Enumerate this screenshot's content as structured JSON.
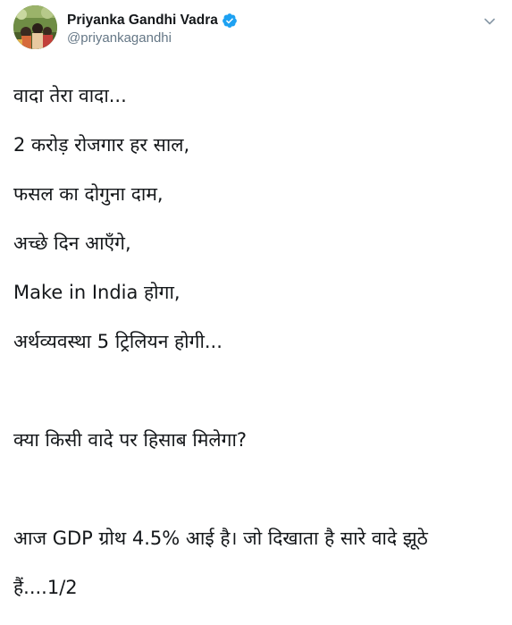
{
  "tweet": {
    "author": {
      "display_name": "Priyanka Gandhi Vadra",
      "handle": "@priyankagandhi",
      "verified": true,
      "avatar_icon": "profile-photo"
    },
    "menu_icon": "chevron-down-icon",
    "text_lines": [
      "वादा तेरा वादा...",
      "2 करोड़ रोजगार हर साल,",
      "फसल का दोगुना दाम,",
      "अच्छे दिन आएँगे,",
      "Make in India होगा,",
      "अर्थव्यवस्था 5 ट्रिलियन होगी...",
      "",
      "क्या किसी वादे पर हिसाब मिलेगा?",
      "",
      "आज GDP ग्रोथ 4.5% आई है। जो दिखाता है सारे वादे झूठे",
      "हैं....1/2"
    ],
    "colors": {
      "verified_badge": "#1da1f2",
      "handle_text": "#657786",
      "body_text": "#14171a"
    }
  }
}
